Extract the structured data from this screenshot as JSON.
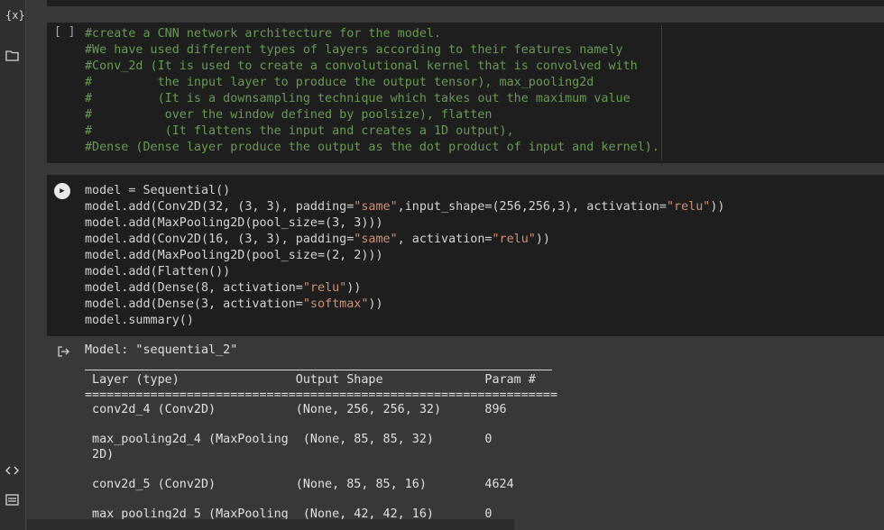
{
  "sidebar": {
    "variables_icon": "{x}",
    "files_icon": "folder-icon",
    "code_snippets_icon": "code-icon",
    "terminal_icon": "terminal-icon"
  },
  "md_cell": {
    "run_indicator": "[ ]",
    "lines": [
      "#create a CNN network architecture for the model.",
      "#We have used different types of layers according to their features namely",
      "#Conv_2d (It is used to create a convolutional kernel that is convolved with",
      "#         the input layer to produce the output tensor), max_pooling2d",
      "#         (It is a downsampling technique which takes out the maximum value",
      "#          over the window defined by poolsize), flatten",
      "#          (It flattens the input and creates a 1D output),",
      "#Dense (Dense layer produce the output as the dot product of input and kernel)."
    ]
  },
  "code_cell": {
    "line1": "model = Sequential()",
    "l2a": "model.add(Conv2D(32, (3, 3), padding=",
    "l2s": "\"same\"",
    "l2b": ",input_shape=(256,256,3), activation=",
    "l2s2": "\"relu\"",
    "l2c": "))",
    "line3": "model.add(MaxPooling2D(pool_size=(3, 3)))",
    "l4a": "model.add(Conv2D(16, (3, 3), padding=",
    "l4s": "\"same\"",
    "l4b": ", activation=",
    "l4s2": "\"relu\"",
    "l4c": "))",
    "line5": "model.add(MaxPooling2D(pool_size=(2, 2)))",
    "line6": "model.add(Flatten())",
    "l7a": "model.add(Dense(8, activation=",
    "l7s": "\"relu\"",
    "l7c": "))",
    "l8a": "model.add(Dense(3, activation=",
    "l8s": "\"softmax\"",
    "l8c": "))",
    "line9": "model.summary()"
  },
  "output": {
    "lines": [
      "Model: \"sequential_2\"",
      "",
      " Layer (type)                Output Shape              Param #   ",
      "=================================================================",
      " conv2d_4 (Conv2D)           (None, 256, 256, 32)      896       ",
      "",
      " max_pooling2d_4 (MaxPooling  (None, 85, 85, 32)       0         ",
      " 2D)",
      "",
      " conv2d_5 (Conv2D)           (None, 85, 85, 16)        4624      ",
      "",
      " max_pooling2d_5 (MaxPooling  (None, 42, 42, 16)       0         "
    ]
  }
}
